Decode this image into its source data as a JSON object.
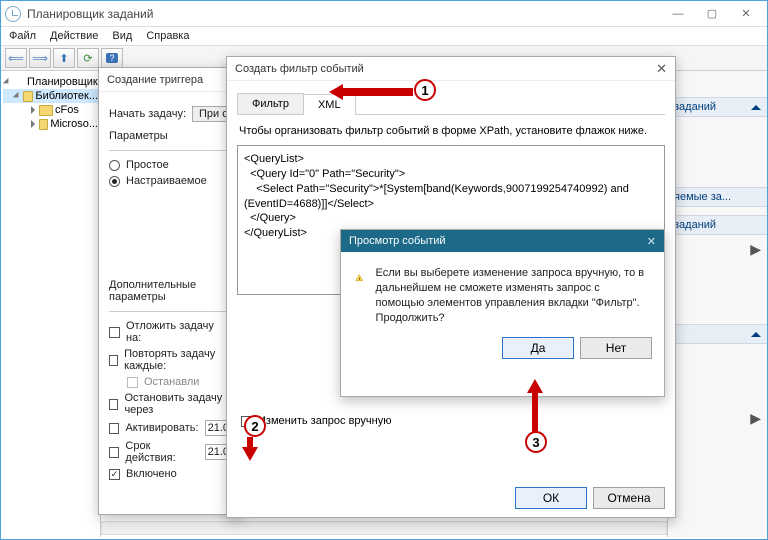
{
  "window": {
    "title": "Планировщик заданий"
  },
  "menus": {
    "file": "Файл",
    "action": "Действие",
    "view": "Вид",
    "help": "Справка"
  },
  "tree": {
    "root": "Планировщик",
    "library": "Библиотек...",
    "items": [
      "cFos",
      "Microso..."
    ]
  },
  "actions_pane": {
    "header1": "заданий",
    "header2": "яемые за...",
    "header3": "заданий"
  },
  "trigger_dlg": {
    "title": "Создание триггера",
    "start_label": "Начать задачу:",
    "start_btn": "При событии",
    "params": "Параметры",
    "simple": "Простое",
    "custom": "Настраиваемое",
    "extras": "Дополнительные параметры",
    "delay": "Отложить задачу на:",
    "repeat": "Повторять задачу каждые:",
    "stopall": "Останавли",
    "stopafter": "Остановить задачу через",
    "activate": "Активировать:",
    "activate_val": "21.0",
    "expire": "Срок действия:",
    "expire_val": "21.0",
    "enabled": "Включено"
  },
  "filter_dlg": {
    "title": "Создать фильтр событий",
    "tab_filter": "Фильтр",
    "tab_xml": "XML",
    "info": "Чтобы организовать фильтр событий в форме XPath, установите флажок ниже.",
    "xml": "<QueryList>\n  <Query Id=\"0\" Path=\"Security\">\n    <Select Path=\"Security\">*[System[band(Keywords,9007199254740992) and (EventID=4688)]]</Select>\n  </Query>\n</QueryList>",
    "manual_edit": "Изменить запрос вручную",
    "ok": "ОК",
    "cancel": "Отмена"
  },
  "msg_dlg": {
    "title": "Просмотр событий",
    "text": "Если вы выберете изменение запроса вручную, то в дальнейшем не сможете изменять запрос с помощью элементов управления вкладки \"Фильтр\". Продолжить?",
    "yes": "Да",
    "no": "Нет"
  },
  "callouts": {
    "c1": "1",
    "c2": "2",
    "c3": "3"
  }
}
